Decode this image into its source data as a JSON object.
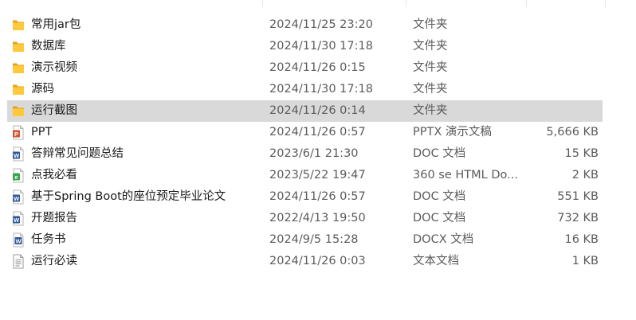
{
  "files": [
    {
      "name": "常用jar包",
      "date": "2024/11/25 23:20",
      "type": "文件夹",
      "size": "",
      "icon": "folder",
      "selected": false
    },
    {
      "name": "数据库",
      "date": "2024/11/30 17:18",
      "type": "文件夹",
      "size": "",
      "icon": "folder",
      "selected": false
    },
    {
      "name": "演示视频",
      "date": "2024/11/26 0:15",
      "type": "文件夹",
      "size": "",
      "icon": "folder",
      "selected": false
    },
    {
      "name": "源码",
      "date": "2024/11/30 17:18",
      "type": "文件夹",
      "size": "",
      "icon": "folder",
      "selected": false
    },
    {
      "name": "运行截图",
      "date": "2024/11/26 0:14",
      "type": "文件夹",
      "size": "",
      "icon": "folder",
      "selected": true
    },
    {
      "name": "PPT",
      "date": "2024/11/26 0:57",
      "type": "PPTX 演示文稿",
      "size": "5,666 KB",
      "icon": "pptx",
      "selected": false
    },
    {
      "name": "答辩常见问题总结",
      "date": "2023/6/1 21:30",
      "type": "DOC 文档",
      "size": "15 KB",
      "icon": "doc",
      "selected": false
    },
    {
      "name": "点我必看",
      "date": "2023/5/22 19:47",
      "type": "360 se HTML Do...",
      "size": "2 KB",
      "icon": "html",
      "selected": false
    },
    {
      "name": "基于Spring Boot的座位预定毕业论文",
      "date": "2024/11/26 0:57",
      "type": "DOC 文档",
      "size": "551 KB",
      "icon": "doc",
      "selected": false
    },
    {
      "name": "开题报告",
      "date": "2022/4/13 19:50",
      "type": "DOC 文档",
      "size": "732 KB",
      "icon": "doc",
      "selected": false
    },
    {
      "name": "任务书",
      "date": "2024/9/5 15:28",
      "type": "DOCX 文档",
      "size": "16 KB",
      "icon": "docx",
      "selected": false
    },
    {
      "name": "运行必读",
      "date": "2024/11/26 0:03",
      "type": "文本文档",
      "size": "1 KB",
      "icon": "txt",
      "selected": false
    }
  ],
  "colors": {
    "selected_row": "#d9d9d9",
    "folder": "#ffc83d",
    "pptx": "#d35230",
    "doc": "#2b579a",
    "html": "#3aa54b",
    "text_secondary": "#5b5b5b"
  }
}
